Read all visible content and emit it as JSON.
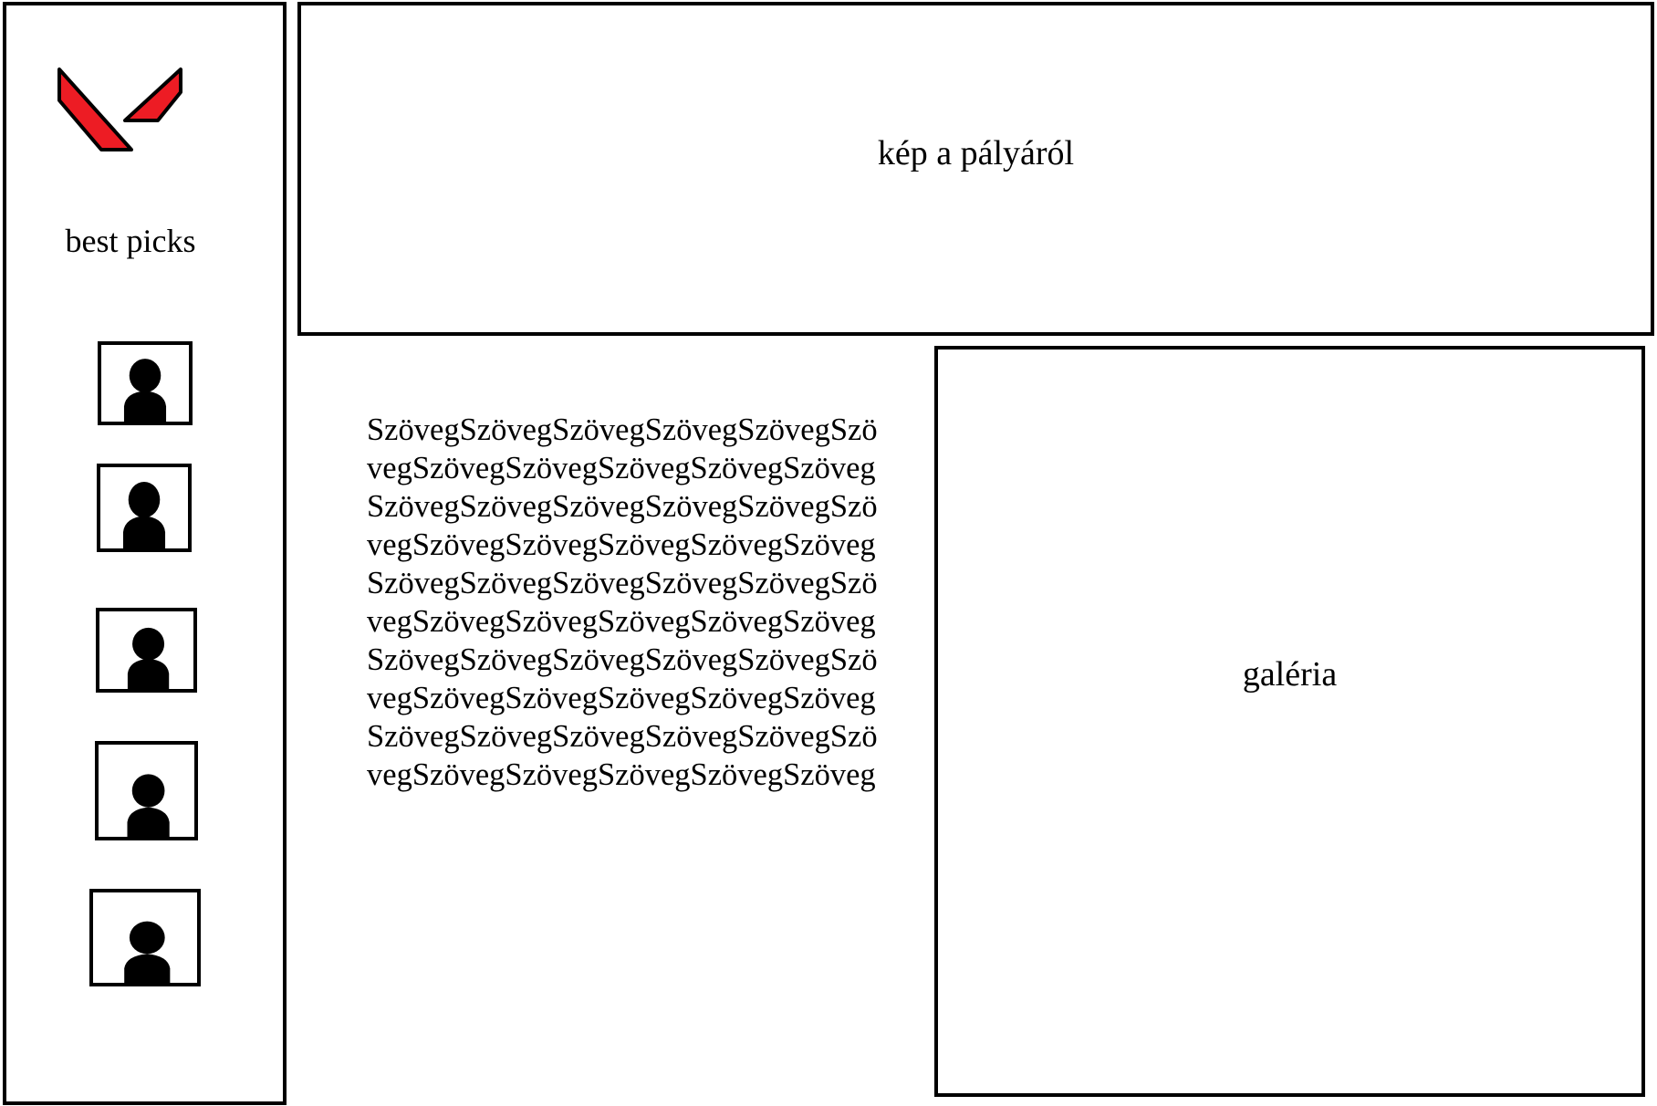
{
  "sidebar": {
    "logo": {
      "icon": "valorant-logo-icon",
      "color": "#ed1c24"
    },
    "title": "best picks",
    "agents": [
      {
        "icon": "person-silhouette-icon"
      },
      {
        "icon": "person-silhouette-icon"
      },
      {
        "icon": "person-silhouette-icon"
      },
      {
        "icon": "person-silhouette-icon"
      },
      {
        "icon": "person-silhouette-icon"
      }
    ]
  },
  "hero": {
    "label": "kép a pályáról"
  },
  "main": {
    "text": "SzövegSzövegSzövegSzövegSzövegSzövegSzövegSzövegSzövegSzövegSzövegSzövegSzövegSzövegSzövegSzövegSzövegSzövegSzövegSzövegSzövegSzövegSzövegSzövegSzövegSzövegSzövegSzövegSzövegSzövegSzövegSzövegSzövegSzövegSzövegSzövegSzövegSzövegSzövegSzövegSzövegSzövegSzövegSzövegSzövegSzövegSzövegSzövegSzövegSzövegSzövegSzövegSzövegSzövegSzöveg"
  },
  "gallery": {
    "label": "galéria"
  }
}
